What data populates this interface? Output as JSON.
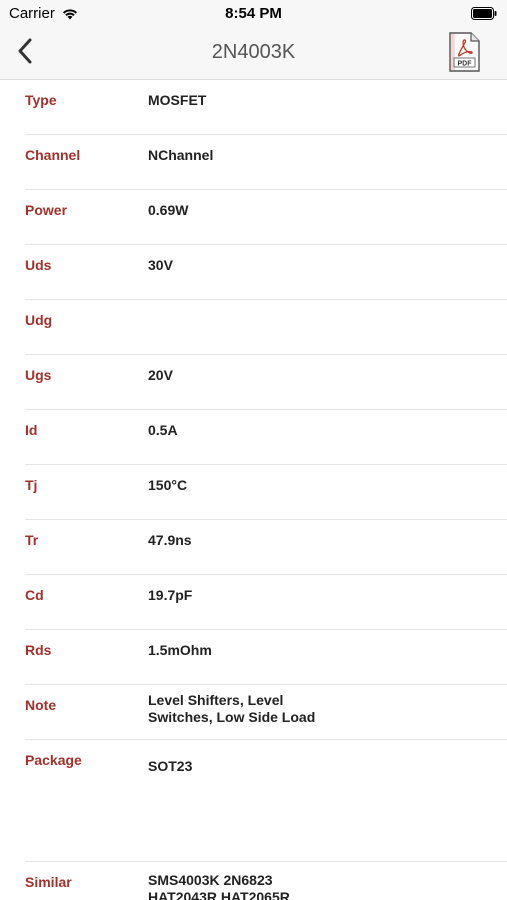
{
  "status_bar": {
    "carrier": "Carrier",
    "time": "8:54 PM"
  },
  "nav": {
    "title": "2N4003K",
    "back_icon": "chevron-left-icon",
    "pdf_icon": "pdf-icon",
    "pdf_label": "PDF"
  },
  "colors": {
    "label": "#a3302a",
    "value": "#222222",
    "nav_title": "#555555"
  },
  "specs": [
    {
      "label": "Type",
      "value": "MOSFET"
    },
    {
      "label": "Channel",
      "value": "NChannel"
    },
    {
      "label": "Power",
      "value": "0.69W"
    },
    {
      "label": "Uds",
      "value": "30V"
    },
    {
      "label": "Udg",
      "value": ""
    },
    {
      "label": "Ugs",
      "value": "20V"
    },
    {
      "label": "Id",
      "value": "0.5A"
    },
    {
      "label": "Tj",
      "value": "150°C"
    },
    {
      "label": "Tr",
      "value": "47.9ns"
    },
    {
      "label": "Cd",
      "value": "19.7pF"
    },
    {
      "label": "Rds",
      "value": "1.5mOhm"
    },
    {
      "label": "Note",
      "value": "Level Shifters, Level Switches, Low Side Load"
    },
    {
      "label": "Package",
      "value": "SOT23"
    },
    {
      "label": "Similar",
      "value": "SMS4003K 2N6823 HAT2043R HAT2065R"
    }
  ]
}
